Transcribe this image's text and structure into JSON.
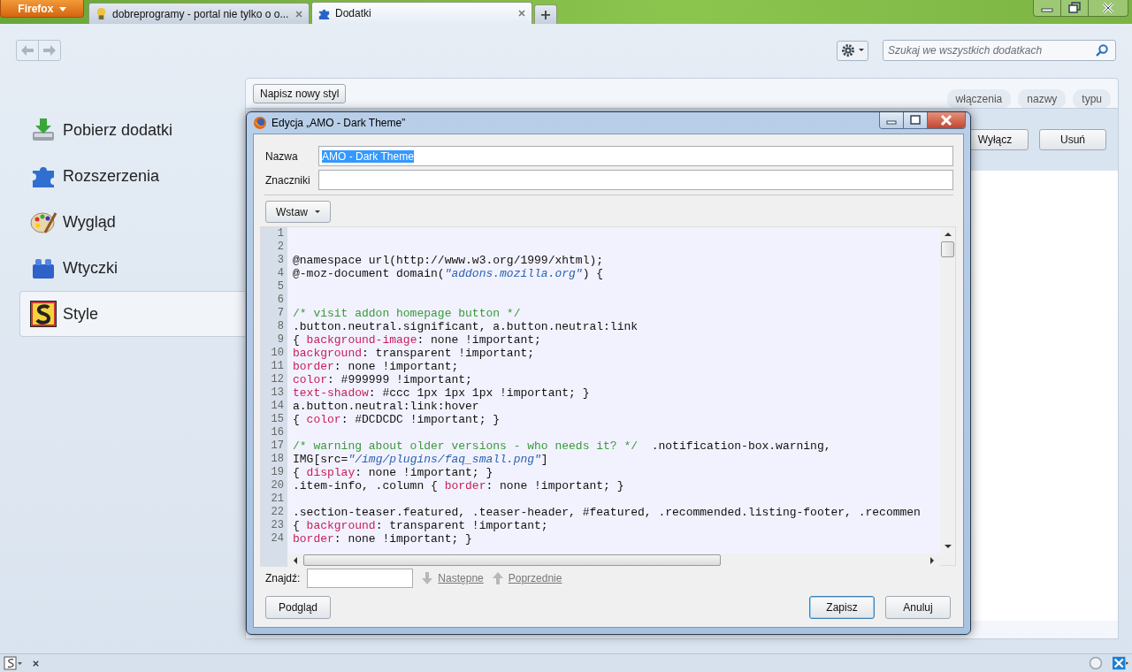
{
  "browser": {
    "menu_button": "Firefox",
    "tabs": [
      {
        "title": "dobreprogramy - portal nie tylko o o...",
        "selected": false,
        "kind": "site"
      },
      {
        "title": "Dodatki",
        "selected": true,
        "kind": "addons"
      }
    ],
    "new_tab": "+"
  },
  "toolbar": {
    "search": {
      "placeholder": "Szukaj we wszystkich dodatkach"
    }
  },
  "sidebar": {
    "items": [
      {
        "label": "Pobierz dodatki",
        "kind": "download",
        "selected": false
      },
      {
        "label": "Rozszerzenia",
        "kind": "puzzle",
        "selected": false
      },
      {
        "label": "Wygląd",
        "kind": "palette",
        "selected": false
      },
      {
        "label": "Wtyczki",
        "kind": "brick",
        "selected": false
      },
      {
        "label": "Style",
        "kind": "style",
        "selected": true
      }
    ]
  },
  "panel": {
    "new_style_button": "Napisz nowy styl",
    "sort_buttons": [
      "włączenia",
      "nazwy",
      "typu"
    ],
    "item_buttons": [
      "Wyłącz",
      "Usuń"
    ]
  },
  "dialog": {
    "title": "Edycja „AMO - Dark Theme”",
    "fields": [
      {
        "label": "Nazwa",
        "value": "AMO - Dark Theme",
        "text_selected": true
      },
      {
        "label": "Znaczniki"
      }
    ],
    "insert_button": "Wstaw",
    "code_lines": [
      {
        "number": "1"
      },
      {
        "number": "2"
      },
      {
        "number": "3",
        "segments": [
          {
            "kind": "text",
            "text": "@namespace url(http://www.w3.org/1999/xhtml);"
          }
        ]
      },
      {
        "number": "4",
        "segments": [
          {
            "kind": "text",
            "text": "@-moz-document domain("
          },
          {
            "kind": "string",
            "text": "\"addons.mozilla.org\""
          },
          {
            "kind": "text",
            "text": ") {"
          }
        ]
      },
      {
        "number": "5"
      },
      {
        "number": "6"
      },
      {
        "number": "7",
        "segments": [
          {
            "kind": "comment",
            "text": "/* visit addon homepage button */"
          }
        ]
      },
      {
        "number": "8",
        "segments": [
          {
            "kind": "text",
            "text": ".button.neutral.significant, a.button.neutral:link"
          }
        ]
      },
      {
        "number": "9",
        "segments": [
          {
            "kind": "text",
            "text": "{ "
          },
          {
            "kind": "property",
            "text": "background-image"
          },
          {
            "kind": "text",
            "text": ": none !important;"
          }
        ]
      },
      {
        "number": "10",
        "segments": [
          {
            "kind": "property",
            "text": "background"
          },
          {
            "kind": "text",
            "text": ": transparent !important;"
          }
        ]
      },
      {
        "number": "11",
        "segments": [
          {
            "kind": "property",
            "text": "border"
          },
          {
            "kind": "text",
            "text": ": none !important;"
          }
        ]
      },
      {
        "number": "12",
        "segments": [
          {
            "kind": "property",
            "text": "color"
          },
          {
            "kind": "text",
            "text": ": #999999 !important;"
          }
        ]
      },
      {
        "number": "13",
        "segments": [
          {
            "kind": "property",
            "text": "text-shadow"
          },
          {
            "kind": "text",
            "text": ": #ccc 1px 1px 1px !important; }"
          }
        ]
      },
      {
        "number": "14",
        "segments": [
          {
            "kind": "text",
            "text": "a.button.neutral:link:hover"
          }
        ]
      },
      {
        "number": "15",
        "segments": [
          {
            "kind": "text",
            "text": "{ "
          },
          {
            "kind": "property",
            "text": "color"
          },
          {
            "kind": "text",
            "text": ": #DCDCDC !important; }"
          }
        ]
      },
      {
        "number": "16"
      },
      {
        "number": "17",
        "segments": [
          {
            "kind": "comment",
            "text": "/* warning about older versions - who needs it? */"
          },
          {
            "kind": "text",
            "text": "  .notification-box.warning,"
          }
        ]
      },
      {
        "number": "18",
        "segments": [
          {
            "kind": "text",
            "text": "IMG[src="
          },
          {
            "kind": "string",
            "text": "\"/img/plugins/faq_small.png\""
          },
          {
            "kind": "text",
            "text": "]"
          }
        ]
      },
      {
        "number": "19",
        "segments": [
          {
            "kind": "text",
            "text": "{ "
          },
          {
            "kind": "property",
            "text": "display"
          },
          {
            "kind": "text",
            "text": ": none !important; }"
          }
        ]
      },
      {
        "number": "20",
        "segments": [
          {
            "kind": "text",
            "text": ".item-info, .column { "
          },
          {
            "kind": "property",
            "text": "border"
          },
          {
            "kind": "text",
            "text": ": none !important; }"
          }
        ]
      },
      {
        "number": "21"
      },
      {
        "number": "22",
        "segments": [
          {
            "kind": "text",
            "text": ".section-teaser.featured, .teaser-header, #featured, .recommended.listing-footer, .recommen"
          }
        ]
      },
      {
        "number": "23",
        "segments": [
          {
            "kind": "text",
            "text": "{ "
          },
          {
            "kind": "property",
            "text": "background"
          },
          {
            "kind": "text",
            "text": ": transparent !important;"
          }
        ]
      },
      {
        "number": "24",
        "segments": [
          {
            "kind": "property",
            "text": "border"
          },
          {
            "kind": "text",
            "text": ": none !important; }"
          }
        ]
      }
    ],
    "find": {
      "label": "Znajdź:",
      "next": {
        "label": "Następne",
        "disabled": true
      },
      "previous": {
        "label": "Poprzednie",
        "disabled": true
      }
    },
    "buttons": [
      {
        "label": "Podgląd",
        "default": false
      },
      {
        "label": "Zapisz",
        "default": true
      },
      {
        "label": "Anuluj",
        "default": false
      }
    ]
  }
}
